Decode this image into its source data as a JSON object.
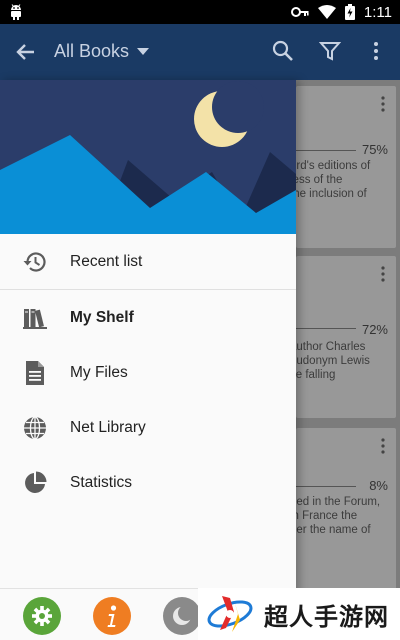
{
  "status_bar": {
    "time": "1:11",
    "icons": [
      "android-icon",
      "key-icon",
      "wifi-icon",
      "battery-icon"
    ]
  },
  "app_bar": {
    "title": "All Books",
    "icons": [
      "back-arrow-icon",
      "dropdown-arrow-icon",
      "search-icon",
      "filter-icon",
      "more-vert-icon"
    ],
    "color": "#1a3a64"
  },
  "background_cards": [
    {
      "progress": "75%",
      "description": "ord's editions of\nless of the\nthe inclusion of"
    },
    {
      "progress": "72%",
      "description": "author Charles\neudonym Lewis\nce falling"
    },
    {
      "progress": "8%",
      "description": "hed in the Forum,\nin France the\nder the name of"
    }
  ],
  "drawer": {
    "header_colors": {
      "sky": "#2b3d6a",
      "mountain_front": "#0a8fd6",
      "mountain_back": "#1c2a4d",
      "moon": "#f3e2a8"
    },
    "menu": [
      {
        "label": "Recent list",
        "icon": "history-icon",
        "active": false
      },
      {
        "label": "My Shelf",
        "icon": "bookshelf-icon",
        "active": true
      },
      {
        "label": "My Files",
        "icon": "file-document-icon",
        "active": false
      },
      {
        "label": "Net Library",
        "icon": "globe-icon",
        "active": false
      },
      {
        "label": "Statistics",
        "icon": "pie-chart-icon",
        "active": false
      }
    ],
    "footer_buttons": [
      {
        "icon": "settings-gear-icon",
        "color": "#5aa53a"
      },
      {
        "icon": "info-icon",
        "color": "#ef7d22"
      },
      {
        "icon": "night-mode-icon",
        "color": "#8a8a8a"
      }
    ]
  },
  "watermark": {
    "text": "超人手游网"
  }
}
